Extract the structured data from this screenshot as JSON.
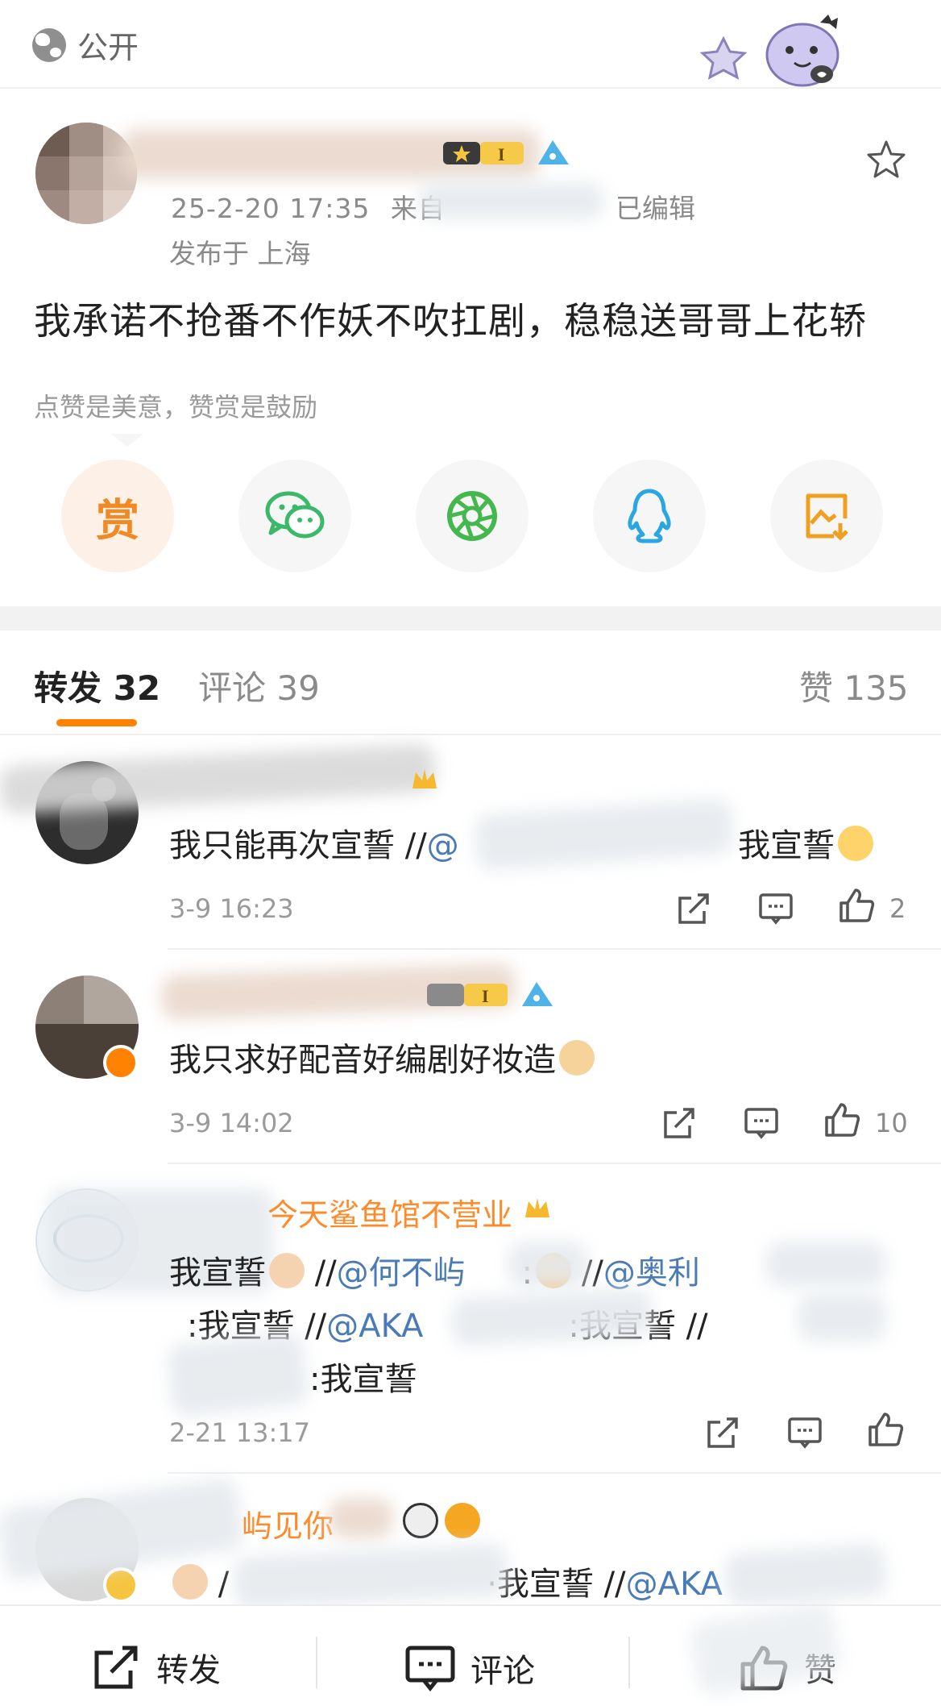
{
  "topbar": {
    "visibility_label": "公开"
  },
  "post": {
    "timestamp": "25-2-20 17:35",
    "source_prefix": "来自",
    "edited_label": "已编辑",
    "location": "发布于 上海",
    "text": "我承诺不抢番不作妖不吹扛剧，稳稳送哥哥上花轿",
    "reward_hint": "点赞是美意，赞赏是鼓励",
    "share_reward_label": "赏"
  },
  "tabs": {
    "repost_label": "转发 32",
    "comment_label": "评论 39",
    "like_label": "赞 135"
  },
  "reposts": [
    {
      "text_prefix": "我只能再次宣誓 //",
      "text_at": "@",
      "text_suffix": "我宣誓",
      "time": "3-9 16:23",
      "likes": "2"
    },
    {
      "text": "我只求好配音好编剧好妆造",
      "time": "3-9 14:02",
      "likes": "10"
    },
    {
      "name": "今天鲨鱼馆不营业",
      "line1_a": "我宣誓",
      "line1_b": "//",
      "line1_at1": "@何不屿",
      "line1_c": ":",
      "line1_d": "//",
      "line1_at2": "@奥利",
      "line2_a": ":我宣誓 //",
      "line2_at": "@AKA",
      "line2_b": ":我宣誓 //",
      "line3": ":我宣誓",
      "time": "2-21 13:17"
    },
    {
      "name": "屿见你",
      "text_a": "/",
      "text_b": "·我宣誓 //",
      "text_at": "@AKA"
    }
  ],
  "bottombar": {
    "repost_label": "转发",
    "comment_label": "评论",
    "like_label": "赞"
  },
  "colors": {
    "accent": "#ff8200",
    "link": "#4a7bb7",
    "muted": "#9a9a9a"
  }
}
